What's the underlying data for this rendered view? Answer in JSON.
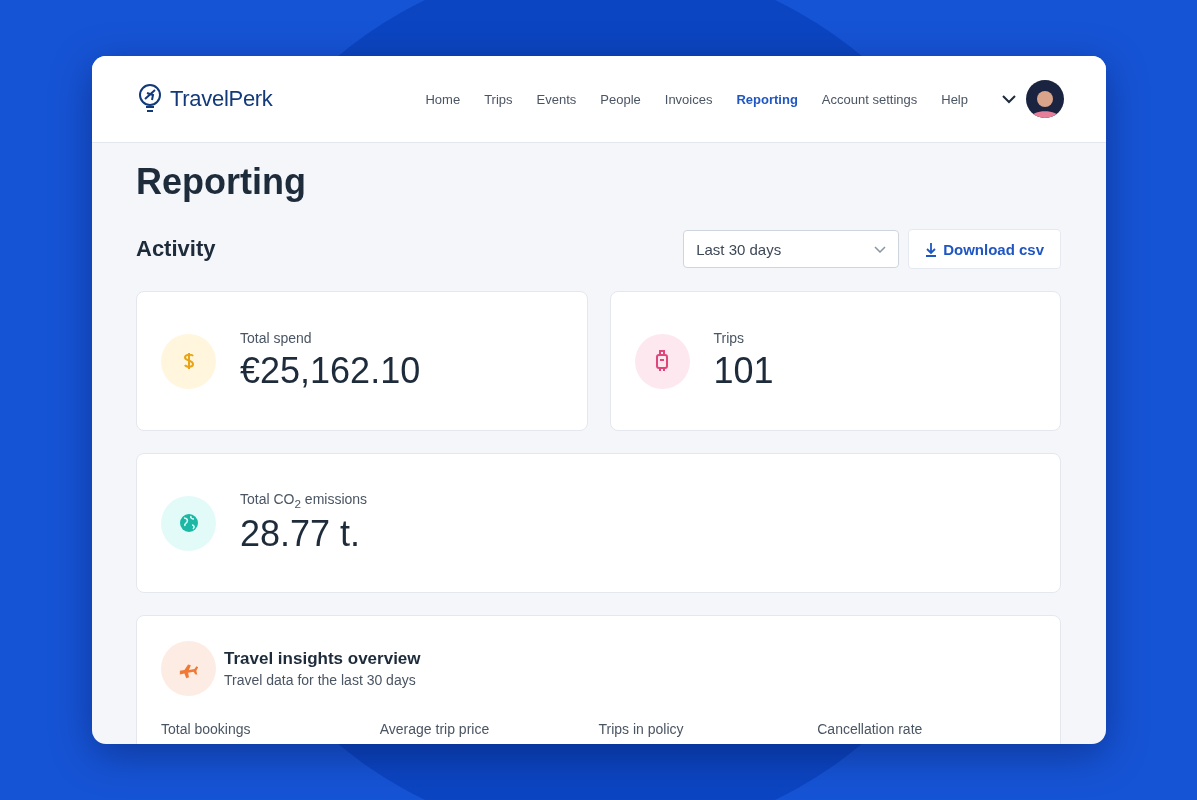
{
  "header": {
    "logo": "TravelPerk",
    "nav": [
      {
        "label": "Home",
        "selected": false
      },
      {
        "label": "Trips",
        "selected": false
      },
      {
        "label": "Events",
        "selected": false
      },
      {
        "label": "People",
        "selected": false
      },
      {
        "label": "Invoices",
        "selected": false
      },
      {
        "label": "Reporting",
        "selected": true
      },
      {
        "label": "Account settings",
        "selected": false
      },
      {
        "label": "Help",
        "selected": false
      }
    ]
  },
  "page": {
    "title": "Reporting",
    "section": "Activity",
    "period": {
      "value": "Last 30 days"
    },
    "download": "Download csv"
  },
  "stats": [
    {
      "kind": "spend",
      "label": "Total spend",
      "value": "€25,162.10",
      "color": "#e8a317"
    },
    {
      "kind": "trips",
      "label": "Trips",
      "value": "101",
      "color": "#e0457b"
    },
    {
      "kind": "emissions",
      "label": "Total CO$_{2}$ emissions",
      "value": "28.77 t.",
      "color": "#1bb8a6"
    }
  ],
  "insights": {
    "title": "Travel insights overview",
    "subtitle": "Travel data for the last 30 days",
    "columns": [
      "Total bookings",
      "Average trip price",
      "Trips in policy",
      "Cancellation rate"
    ]
  }
}
